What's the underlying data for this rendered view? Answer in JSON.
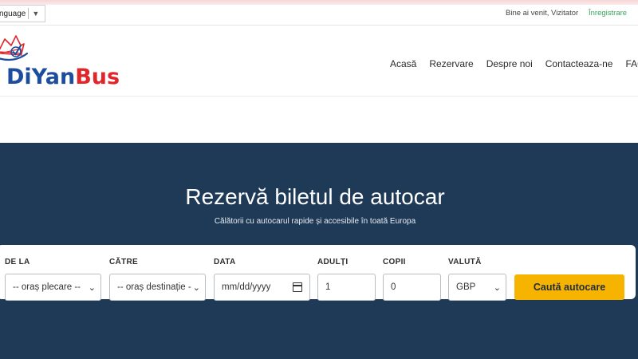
{
  "topbar": {
    "language_label": "nguage",
    "welcome_text": "Bine ai venit, Vizitator",
    "register_link": "Înregistrare"
  },
  "logo": {
    "part1": "DiYan",
    "part2": "Bus",
    "color_primary": "#1d4e9e",
    "color_secondary": "#e0262a"
  },
  "nav": {
    "items": [
      {
        "label": "Acasă"
      },
      {
        "label": "Rezervare"
      },
      {
        "label": "Despre noi"
      },
      {
        "label": "Contacteaza-ne"
      },
      {
        "label": "FAQ"
      }
    ]
  },
  "hero": {
    "title": "Rezervă biletul de autocar",
    "subtitle": "Călătorii cu autocarul rapide și accesibile în toată Europa",
    "background_color": "#1f3a57"
  },
  "search": {
    "from_label": "DE LA",
    "from_value": "-- oraș plecare --",
    "to_label": "CĂTRE",
    "to_value": "-- oraș destinație --",
    "date_label": "DATA",
    "date_placeholder": "mm/dd/yyyy",
    "adults_label": "ADULȚI",
    "adults_value": "1",
    "children_label": "COPII",
    "children_value": "0",
    "currency_label": "VALUTĂ",
    "currency_value": "GBP",
    "button_label": "Caută autocare",
    "button_color": "#f6b400"
  }
}
